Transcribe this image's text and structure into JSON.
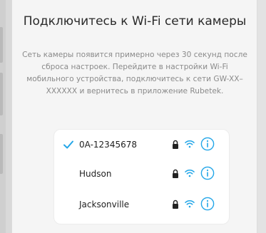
{
  "screen": {
    "title": "Подключитесь к Wi-Fi сети камеры",
    "description": "Сеть камеры появится примерно через 30 секунд после сброса настроек. Перейдите в настройки Wi-Fi мобильного устройства, подключитесь к сети GW-XX–XXXXXX и вернитесь в приложение Rubetek."
  },
  "networks": [
    {
      "name": "0A-12345678",
      "selected": true
    },
    {
      "name": "Hudson",
      "selected": false
    },
    {
      "name": "Jacksonville",
      "selected": false
    }
  ],
  "colors": {
    "accent": "#23a6e8",
    "title": "#2a2a2a",
    "description": "#8a8a8a",
    "background": "#f5f5f5"
  },
  "icons": {
    "selected": "checkmark-icon",
    "secure": "lock-icon",
    "signal": "wifi-icon",
    "details": "info-icon"
  }
}
